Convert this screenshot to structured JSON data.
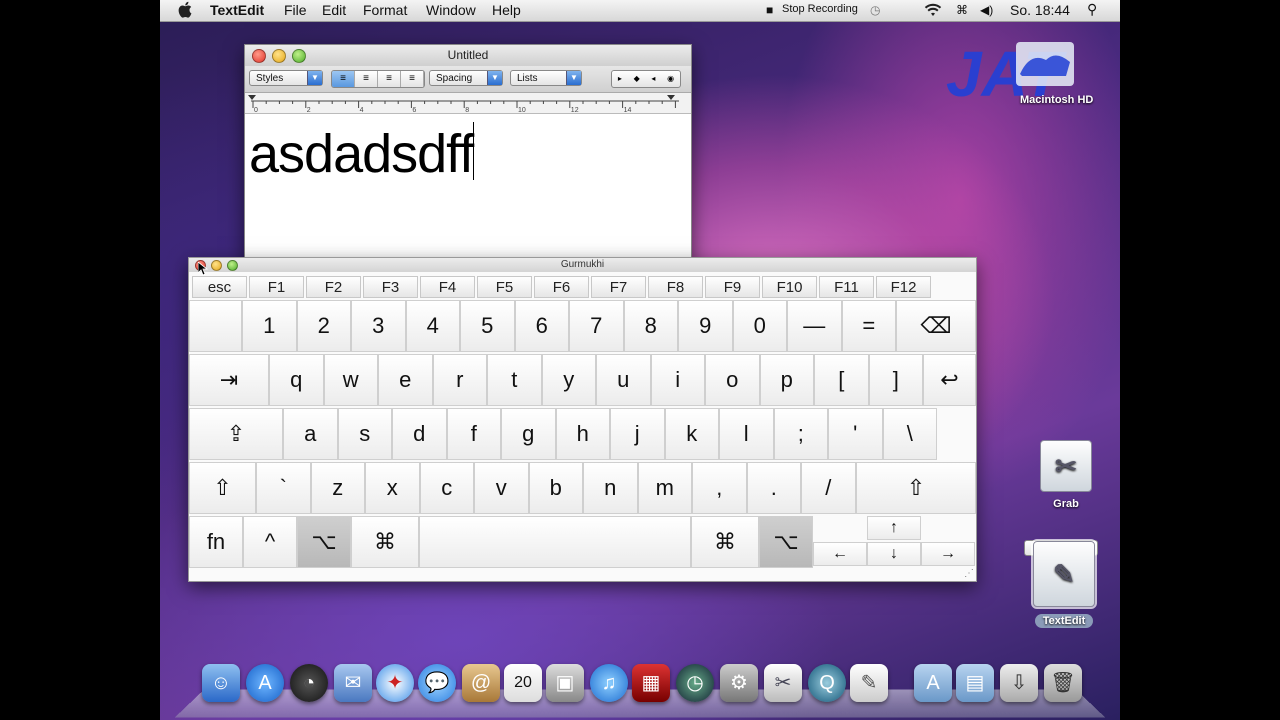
{
  "menubar": {
    "app": "TextEdit",
    "items": [
      "File",
      "Edit",
      "Format",
      "Window",
      "Help"
    ],
    "stop_recording": "Stop Recording",
    "clock": "So. 18:44"
  },
  "textedit": {
    "title": "Untitled",
    "styles_label": "Styles",
    "spacing_label": "Spacing",
    "lists_label": "Lists",
    "ruler_ticks": [
      "0",
      "2",
      "4",
      "6",
      "8",
      "10",
      "12",
      "14"
    ],
    "document_text": "asdadsdff"
  },
  "keyboard": {
    "title": "Gurmukhi",
    "fkeys": [
      "esc",
      "F1",
      "F2",
      "F3",
      "F4",
      "F5",
      "F6",
      "F7",
      "F8",
      "F9",
      "F10",
      "F11",
      "F12"
    ],
    "row1": [
      "",
      "1",
      "2",
      "3",
      "4",
      "5",
      "6",
      "7",
      "8",
      "9",
      "0",
      "—",
      "=",
      "⌫"
    ],
    "row2": [
      "⇥",
      "q",
      "w",
      "e",
      "r",
      "t",
      "y",
      "u",
      "i",
      "o",
      "p",
      "[",
      "]",
      "↩"
    ],
    "row3": [
      "⇪",
      "a",
      "s",
      "d",
      "f",
      "g",
      "h",
      "j",
      "k",
      "l",
      ";",
      "'",
      "\\"
    ],
    "row4": [
      "⇧",
      "`",
      "z",
      "x",
      "c",
      "v",
      "b",
      "n",
      "m",
      ",",
      ".",
      "/",
      "⇧"
    ],
    "row5": [
      "fn",
      "^",
      "⌥",
      "⌘",
      "",
      "⌘",
      "⌥"
    ],
    "arrows": [
      "↑",
      "←",
      "↓",
      "→"
    ]
  },
  "desktop": {
    "hd_label": "Macintosh HD",
    "grab_label": "Grab",
    "textedit_label": "TextEdit",
    "calendar_day": "20"
  }
}
